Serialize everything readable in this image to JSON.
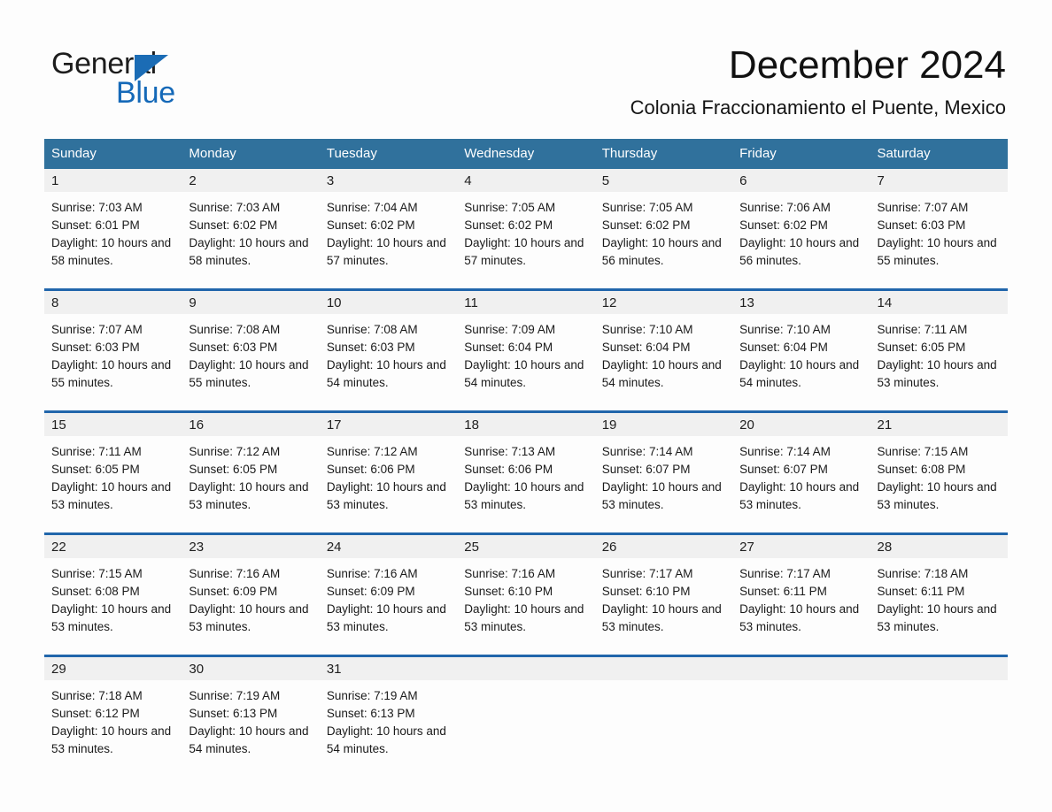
{
  "logo": {
    "word_one": "General",
    "word_two": "Blue",
    "triangle_icon": "triangle-icon",
    "brand_blue": "#1569b8"
  },
  "header": {
    "title": "December 2024",
    "location": "Colonia Fraccionamiento el Puente, Mexico"
  },
  "colors": {
    "header_row_bg": "#30719c",
    "week_separator": "#2166ab",
    "daynum_bg": "#f0f0f0",
    "page_bg": "#fdfdfd"
  },
  "calendar": {
    "weekdays": [
      "Sunday",
      "Monday",
      "Tuesday",
      "Wednesday",
      "Thursday",
      "Friday",
      "Saturday"
    ],
    "weeks": [
      {
        "days": [
          {
            "num": "1",
            "sunrise": "Sunrise: 7:03 AM",
            "sunset": "Sunset: 6:01 PM",
            "daylight": "Daylight: 10 hours and 58 minutes."
          },
          {
            "num": "2",
            "sunrise": "Sunrise: 7:03 AM",
            "sunset": "Sunset: 6:02 PM",
            "daylight": "Daylight: 10 hours and 58 minutes."
          },
          {
            "num": "3",
            "sunrise": "Sunrise: 7:04 AM",
            "sunset": "Sunset: 6:02 PM",
            "daylight": "Daylight: 10 hours and 57 minutes."
          },
          {
            "num": "4",
            "sunrise": "Sunrise: 7:05 AM",
            "sunset": "Sunset: 6:02 PM",
            "daylight": "Daylight: 10 hours and 57 minutes."
          },
          {
            "num": "5",
            "sunrise": "Sunrise: 7:05 AM",
            "sunset": "Sunset: 6:02 PM",
            "daylight": "Daylight: 10 hours and 56 minutes."
          },
          {
            "num": "6",
            "sunrise": "Sunrise: 7:06 AM",
            "sunset": "Sunset: 6:02 PM",
            "daylight": "Daylight: 10 hours and 56 minutes."
          },
          {
            "num": "7",
            "sunrise": "Sunrise: 7:07 AM",
            "sunset": "Sunset: 6:03 PM",
            "daylight": "Daylight: 10 hours and 55 minutes."
          }
        ]
      },
      {
        "days": [
          {
            "num": "8",
            "sunrise": "Sunrise: 7:07 AM",
            "sunset": "Sunset: 6:03 PM",
            "daylight": "Daylight: 10 hours and 55 minutes."
          },
          {
            "num": "9",
            "sunrise": "Sunrise: 7:08 AM",
            "sunset": "Sunset: 6:03 PM",
            "daylight": "Daylight: 10 hours and 55 minutes."
          },
          {
            "num": "10",
            "sunrise": "Sunrise: 7:08 AM",
            "sunset": "Sunset: 6:03 PM",
            "daylight": "Daylight: 10 hours and 54 minutes."
          },
          {
            "num": "11",
            "sunrise": "Sunrise: 7:09 AM",
            "sunset": "Sunset: 6:04 PM",
            "daylight": "Daylight: 10 hours and 54 minutes."
          },
          {
            "num": "12",
            "sunrise": "Sunrise: 7:10 AM",
            "sunset": "Sunset: 6:04 PM",
            "daylight": "Daylight: 10 hours and 54 minutes."
          },
          {
            "num": "13",
            "sunrise": "Sunrise: 7:10 AM",
            "sunset": "Sunset: 6:04 PM",
            "daylight": "Daylight: 10 hours and 54 minutes."
          },
          {
            "num": "14",
            "sunrise": "Sunrise: 7:11 AM",
            "sunset": "Sunset: 6:05 PM",
            "daylight": "Daylight: 10 hours and 53 minutes."
          }
        ]
      },
      {
        "days": [
          {
            "num": "15",
            "sunrise": "Sunrise: 7:11 AM",
            "sunset": "Sunset: 6:05 PM",
            "daylight": "Daylight: 10 hours and 53 minutes."
          },
          {
            "num": "16",
            "sunrise": "Sunrise: 7:12 AM",
            "sunset": "Sunset: 6:05 PM",
            "daylight": "Daylight: 10 hours and 53 minutes."
          },
          {
            "num": "17",
            "sunrise": "Sunrise: 7:12 AM",
            "sunset": "Sunset: 6:06 PM",
            "daylight": "Daylight: 10 hours and 53 minutes."
          },
          {
            "num": "18",
            "sunrise": "Sunrise: 7:13 AM",
            "sunset": "Sunset: 6:06 PM",
            "daylight": "Daylight: 10 hours and 53 minutes."
          },
          {
            "num": "19",
            "sunrise": "Sunrise: 7:14 AM",
            "sunset": "Sunset: 6:07 PM",
            "daylight": "Daylight: 10 hours and 53 minutes."
          },
          {
            "num": "20",
            "sunrise": "Sunrise: 7:14 AM",
            "sunset": "Sunset: 6:07 PM",
            "daylight": "Daylight: 10 hours and 53 minutes."
          },
          {
            "num": "21",
            "sunrise": "Sunrise: 7:15 AM",
            "sunset": "Sunset: 6:08 PM",
            "daylight": "Daylight: 10 hours and 53 minutes."
          }
        ]
      },
      {
        "days": [
          {
            "num": "22",
            "sunrise": "Sunrise: 7:15 AM",
            "sunset": "Sunset: 6:08 PM",
            "daylight": "Daylight: 10 hours and 53 minutes."
          },
          {
            "num": "23",
            "sunrise": "Sunrise: 7:16 AM",
            "sunset": "Sunset: 6:09 PM",
            "daylight": "Daylight: 10 hours and 53 minutes."
          },
          {
            "num": "24",
            "sunrise": "Sunrise: 7:16 AM",
            "sunset": "Sunset: 6:09 PM",
            "daylight": "Daylight: 10 hours and 53 minutes."
          },
          {
            "num": "25",
            "sunrise": "Sunrise: 7:16 AM",
            "sunset": "Sunset: 6:10 PM",
            "daylight": "Daylight: 10 hours and 53 minutes."
          },
          {
            "num": "26",
            "sunrise": "Sunrise: 7:17 AM",
            "sunset": "Sunset: 6:10 PM",
            "daylight": "Daylight: 10 hours and 53 minutes."
          },
          {
            "num": "27",
            "sunrise": "Sunrise: 7:17 AM",
            "sunset": "Sunset: 6:11 PM",
            "daylight": "Daylight: 10 hours and 53 minutes."
          },
          {
            "num": "28",
            "sunrise": "Sunrise: 7:18 AM",
            "sunset": "Sunset: 6:11 PM",
            "daylight": "Daylight: 10 hours and 53 minutes."
          }
        ]
      },
      {
        "days": [
          {
            "num": "29",
            "sunrise": "Sunrise: 7:18 AM",
            "sunset": "Sunset: 6:12 PM",
            "daylight": "Daylight: 10 hours and 53 minutes."
          },
          {
            "num": "30",
            "sunrise": "Sunrise: 7:19 AM",
            "sunset": "Sunset: 6:13 PM",
            "daylight": "Daylight: 10 hours and 54 minutes."
          },
          {
            "num": "31",
            "sunrise": "Sunrise: 7:19 AM",
            "sunset": "Sunset: 6:13 PM",
            "daylight": "Daylight: 10 hours and 54 minutes."
          },
          {
            "num": "",
            "sunrise": "",
            "sunset": "",
            "daylight": ""
          },
          {
            "num": "",
            "sunrise": "",
            "sunset": "",
            "daylight": ""
          },
          {
            "num": "",
            "sunrise": "",
            "sunset": "",
            "daylight": ""
          },
          {
            "num": "",
            "sunrise": "",
            "sunset": "",
            "daylight": ""
          }
        ]
      }
    ]
  }
}
